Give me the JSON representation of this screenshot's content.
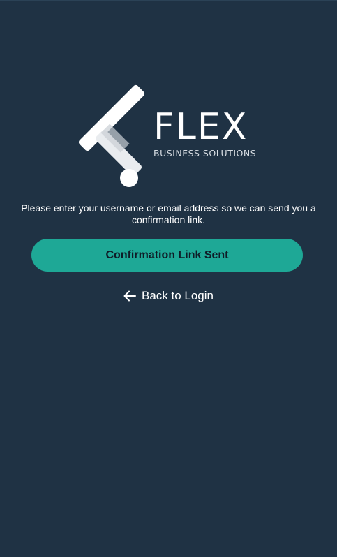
{
  "brand": {
    "name": "FLEX",
    "tagline": "BUSINESS SOLUTIONS",
    "logo_icon": "flex-logo-icon"
  },
  "instructions": "Please enter your username or email address so we can send you a confirmation link.",
  "confirm_button": {
    "label": "Confirmation Link Sent",
    "color": "#1ea896"
  },
  "back_link": {
    "icon": "arrow-left-icon",
    "label": "Back to Login"
  },
  "colors": {
    "background": "#1f3244",
    "accent": "#1ea896"
  }
}
